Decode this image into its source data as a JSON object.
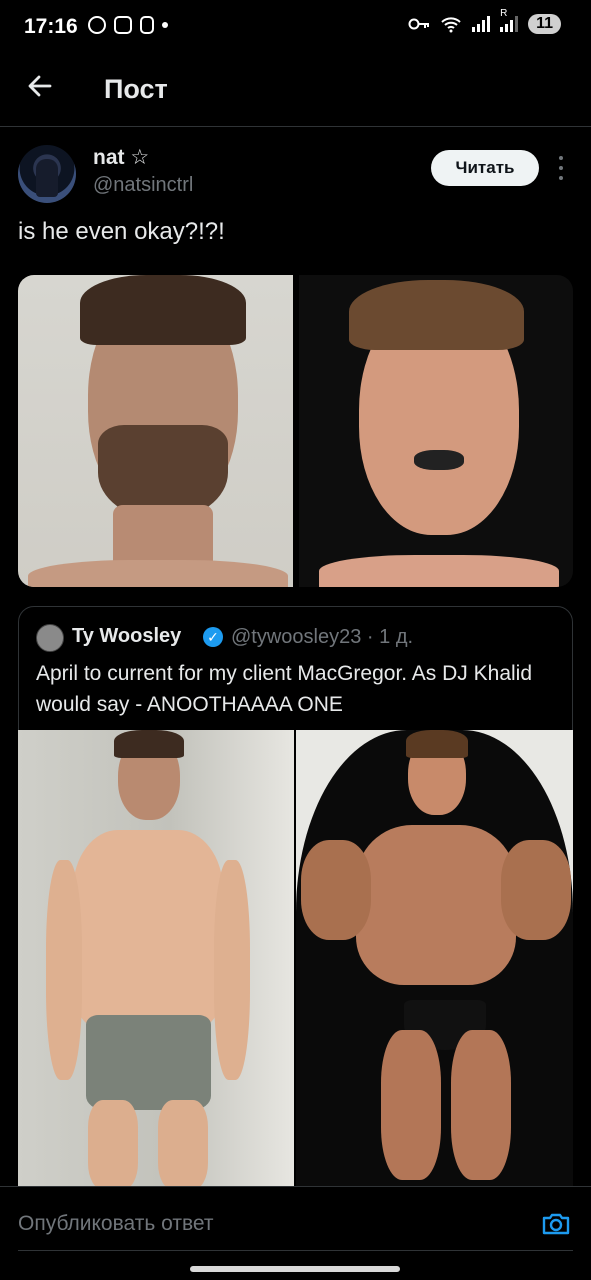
{
  "status_bar": {
    "time": "17:16",
    "battery": "11",
    "network_label": "R"
  },
  "header": {
    "title": "Пост"
  },
  "post": {
    "author_name": "nat ☆",
    "author_handle": "@natsinctrl",
    "follow_label": "Читать",
    "text": "is he even okay?!?!"
  },
  "quoted_post": {
    "author_name": "Ty Woosley",
    "author_handle": "@tywoosley23 · 1 д.",
    "verified_mark": "✓",
    "text": "April to current for my client MacGregor. As DJ Khalid would say - ANOOTHAAAA ONE"
  },
  "reply": {
    "placeholder": "Опубликовать ответ"
  },
  "colors": {
    "background": "#000000",
    "text_primary": "#e7e9ea",
    "text_secondary": "#71767b",
    "verified": "#1d9bf0",
    "border": "#2f3336"
  }
}
